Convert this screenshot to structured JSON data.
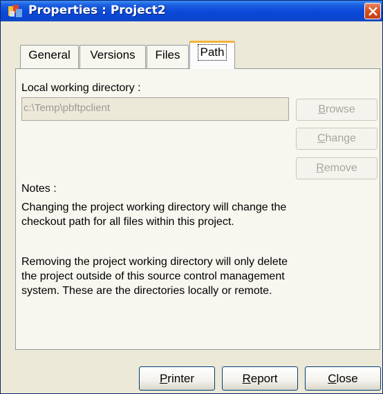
{
  "window": {
    "title": "Properties : Project2"
  },
  "tabs": [
    {
      "label": "General"
    },
    {
      "label": "Versions"
    },
    {
      "label": "Files"
    },
    {
      "label": "Path",
      "active": true
    }
  ],
  "path_tab": {
    "local_dir_label": "Local working directory :",
    "local_dir_value": "c:\\Temp\\pbftpclient",
    "browse": {
      "underlined": "B",
      "rest": "rowse"
    },
    "change": {
      "underlined": "C",
      "rest": "hange"
    },
    "remove": {
      "underlined": "R",
      "rest": "emove"
    },
    "notes_label": "Notes :",
    "note1_line1": "Changing the project working directory will change the",
    "note1_line2": "checkout path for all files within this project.",
    "note2_line1": "Removing the project working directory will only delete",
    "note2_line2": "the project outside of this source control management",
    "note2_line3": "system.  These are the directories locally or remote."
  },
  "footer": {
    "printer": {
      "underlined": "P",
      "rest": "rinter"
    },
    "report": {
      "underlined": "R",
      "rest": "eport"
    },
    "close": {
      "underlined": "C",
      "rest": "lose"
    }
  },
  "colors": {
    "titlebar": "#0a48d8",
    "dialog_bg": "#ece9d8",
    "active_tab_accent": "#f3b33a",
    "close_button": "#d8521f"
  }
}
